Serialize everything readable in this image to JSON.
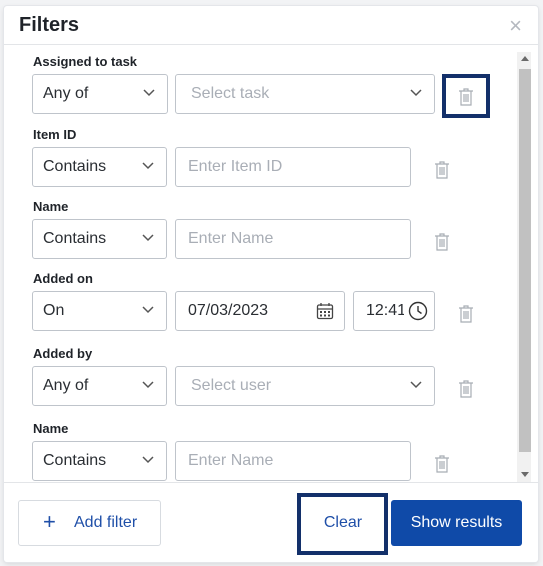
{
  "dialog": {
    "title": "Filters",
    "close_glyph": "×"
  },
  "filters": [
    {
      "label": "Assigned to task",
      "operator": "Any of",
      "value_placeholder": "Select task",
      "highlighted": true
    },
    {
      "label": "Item ID",
      "operator": "Contains",
      "value_placeholder": "Enter Item ID"
    },
    {
      "label": "Name",
      "operator": "Contains",
      "value_placeholder": "Enter Name"
    },
    {
      "label": "Added on",
      "operator": "On",
      "date_value": "07/03/2023",
      "time_value": "12:41"
    },
    {
      "label": "Added by",
      "operator": "Any of",
      "value_placeholder": "Select user"
    },
    {
      "label": "Name",
      "operator": "Contains",
      "value_placeholder": "Enter Name"
    }
  ],
  "footer": {
    "add_filter_label": "Add filter",
    "add_filter_icon": "+",
    "clear_label": "Clear",
    "show_results_label": "Show results"
  },
  "colors": {
    "primary": "#0f4aa8",
    "link": "#1f4fa8",
    "highlight_border": "#13306a",
    "border": "#bfc4cb",
    "placeholder": "#a9aeb6"
  },
  "icons": {
    "trash": "trash-icon",
    "chevron": "chevron-down-icon",
    "calendar": "calendar-icon",
    "clock": "clock-icon",
    "close": "close-icon",
    "plus": "plus-icon"
  }
}
